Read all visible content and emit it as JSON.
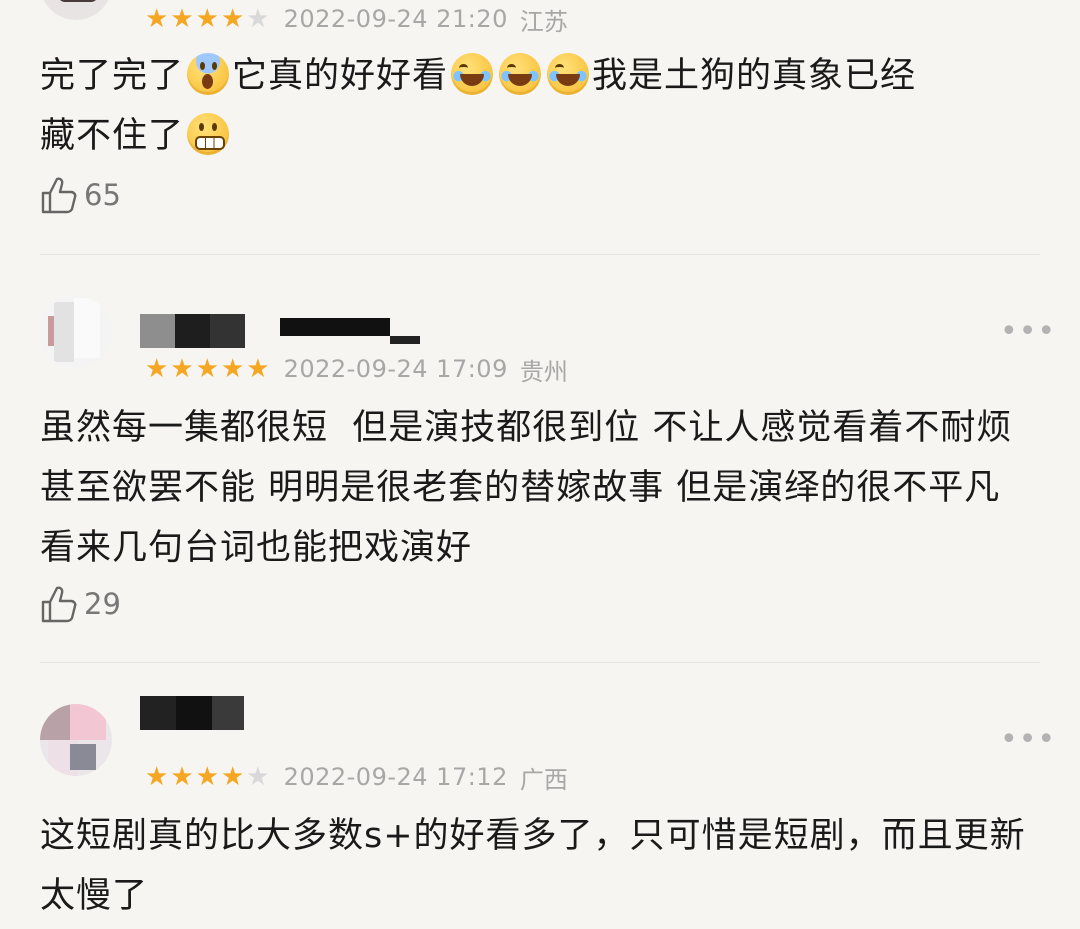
{
  "colors": {
    "star": "#f5a623",
    "star_off": "#d9d9d9",
    "meta_text": "#a7a7a7",
    "background": "#f6f5f1"
  },
  "reviews": [
    {
      "rating": 4,
      "date": "2022-09-24 21:20",
      "location": "江苏",
      "content_parts": [
        "完了完了",
        "它真的好好看",
        "我是土狗的真象已经",
        "藏不住了"
      ],
      "emojis": [
        "face-screaming-in-fear",
        "face-with-tears-of-joy",
        "grimacing-face"
      ],
      "likes": "65"
    },
    {
      "rating": 5,
      "date": "2022-09-24 17:09",
      "location": "贵州",
      "content": "虽然每一集都很短  但是演技都很到位 不让人感觉看着不耐烦 甚至欲罢不能 明明是很老套的替嫁故事 但是演绎的很不平凡 看来几句台词也能把戏演好",
      "likes": "29"
    },
    {
      "rating": 4,
      "date": "2022-09-24 17:12",
      "location": "广西",
      "content": "这短剧真的比大多数s+的好看多了，只可惜是短剧，而且更新太慢了"
    }
  ],
  "more_label": "•••"
}
